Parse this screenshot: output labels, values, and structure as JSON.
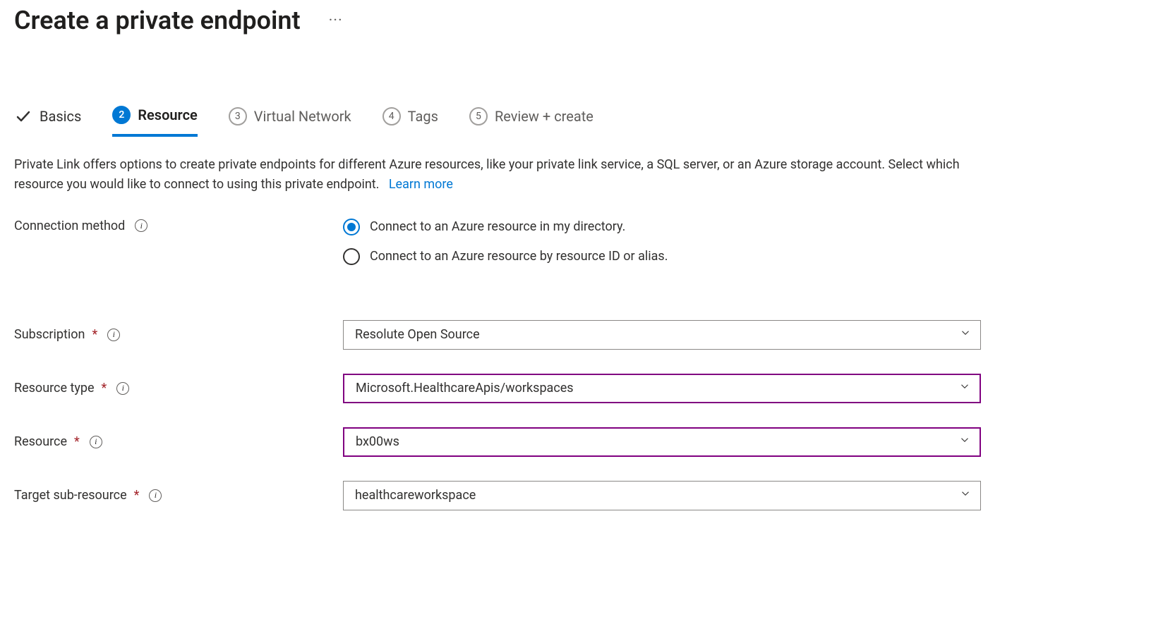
{
  "title": "Create a private endpoint",
  "tabs": {
    "basics": "Basics",
    "resource": {
      "number": "2",
      "label": "Resource"
    },
    "vnet": {
      "number": "3",
      "label": "Virtual Network"
    },
    "tags": {
      "number": "4",
      "label": "Tags"
    },
    "review": {
      "number": "5",
      "label": "Review + create"
    }
  },
  "description": "Private Link offers options to create private endpoints for different Azure resources, like your private link service, a SQL server, or an Azure storage account. Select which resource you would like to connect to using this private endpoint.",
  "learn_more": "Learn more",
  "labels": {
    "connection_method": "Connection method",
    "subscription": "Subscription",
    "resource_type": "Resource type",
    "resource": "Resource",
    "target_sub_resource": "Target sub-resource"
  },
  "radio": {
    "in_directory": "Connect to an Azure resource in my directory.",
    "by_id": "Connect to an Azure resource by resource ID or alias."
  },
  "values": {
    "subscription": "Resolute Open Source",
    "resource_type": "Microsoft.HealthcareApis/workspaces",
    "resource": "bx00ws",
    "target_sub_resource": "healthcareworkspace"
  }
}
